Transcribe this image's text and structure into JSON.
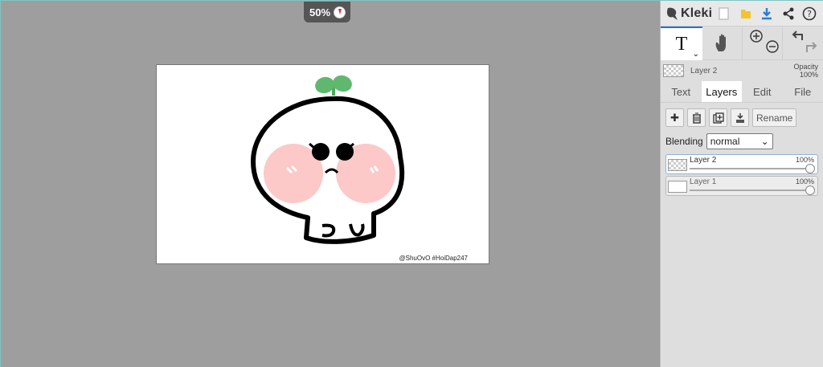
{
  "canvas": {
    "zoom_label": "50%",
    "watermark": "@ShuOvO #HoiDap247"
  },
  "sidebar": {
    "app_name": "Kleki",
    "top_icons": [
      "new-image-icon",
      "open-folder-icon",
      "download-icon",
      "share-icon",
      "help-icon"
    ],
    "tools": [
      "text-tool-icon",
      "hand-tool-icon",
      "zoom-in-icon",
      "zoom-out-icon",
      "undo-icon",
      "redo-icon"
    ],
    "current_layer": {
      "name": "Layer 2",
      "opacity_label": "Opacity",
      "opacity_value": "100%"
    },
    "tabs": [
      {
        "label": "Text"
      },
      {
        "label": "Layers",
        "active": true
      },
      {
        "label": "Edit"
      },
      {
        "label": "File"
      }
    ],
    "actions": {
      "rename_label": "Rename"
    },
    "blending": {
      "label": "Blending",
      "value": "normal"
    },
    "layers": [
      {
        "name": "Layer 2",
        "opacity": "100%",
        "selected": true
      },
      {
        "name": "Layer 1",
        "opacity": "100%",
        "selected": false
      }
    ],
    "accent_color": "#2a6ed6"
  }
}
